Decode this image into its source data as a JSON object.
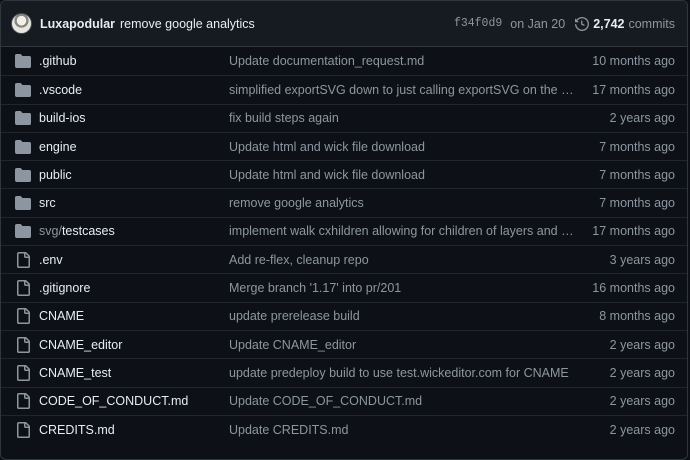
{
  "header": {
    "author": "Luxapodular",
    "message": "remove google analytics",
    "sha": "f34f0d9",
    "date": "on Jan 20",
    "commit_count": "2,742",
    "commits_label": "commits"
  },
  "files": [
    {
      "prefix": "",
      "name": ".github",
      "type": "folder",
      "message": "Update documentation_request.md",
      "age": "10 months ago"
    },
    {
      "prefix": "",
      "name": ".vscode",
      "type": "folder",
      "message": "simplified exportSVG down to just calling exportSVG on the paper.pro…",
      "age": "17 months ago"
    },
    {
      "prefix": "",
      "name": "build-ios",
      "type": "folder",
      "message": "fix build steps again",
      "age": "2 years ago"
    },
    {
      "prefix": "",
      "name": "engine",
      "type": "folder",
      "message": "Update html and wick file download",
      "age": "7 months ago"
    },
    {
      "prefix": "",
      "name": "public",
      "type": "folder",
      "message": "Update html and wick file download",
      "age": "7 months ago"
    },
    {
      "prefix": "",
      "name": "src",
      "type": "folder",
      "message": "remove google analytics",
      "age": "7 months ago"
    },
    {
      "prefix": "svg/",
      "name": "testcases",
      "type": "folder",
      "message": "implement walk cxhildren allowing for children of layers and groups",
      "age": "17 months ago"
    },
    {
      "prefix": "",
      "name": ".env",
      "type": "file",
      "message": "Add re-flex, cleanup repo",
      "age": "3 years ago"
    },
    {
      "prefix": "",
      "name": ".gitignore",
      "type": "file",
      "message": "Merge branch '1.17' into pr/201",
      "age": "16 months ago"
    },
    {
      "prefix": "",
      "name": "CNAME",
      "type": "file",
      "message": "update prerelease build",
      "age": "8 months ago"
    },
    {
      "prefix": "",
      "name": "CNAME_editor",
      "type": "file",
      "message": "Update CNAME_editor",
      "age": "2 years ago"
    },
    {
      "prefix": "",
      "name": "CNAME_test",
      "type": "file",
      "message": "update predeploy build to use test.wickeditor.com for CNAME",
      "age": "2 years ago"
    },
    {
      "prefix": "",
      "name": "CODE_OF_CONDUCT.md",
      "type": "file",
      "message": "Update CODE_OF_CONDUCT.md",
      "age": "2 years ago"
    },
    {
      "prefix": "",
      "name": "CREDITS.md",
      "type": "file",
      "message": "Update CREDITS.md",
      "age": "2 years ago"
    }
  ],
  "icons": {
    "folder": "folder-icon",
    "file": "file-icon",
    "history": "history-icon"
  },
  "colors": {
    "background": "#0d1117",
    "header": "#161b22",
    "border": "#30363d",
    "muted": "#8d96a0",
    "text": "#e6edf3"
  }
}
